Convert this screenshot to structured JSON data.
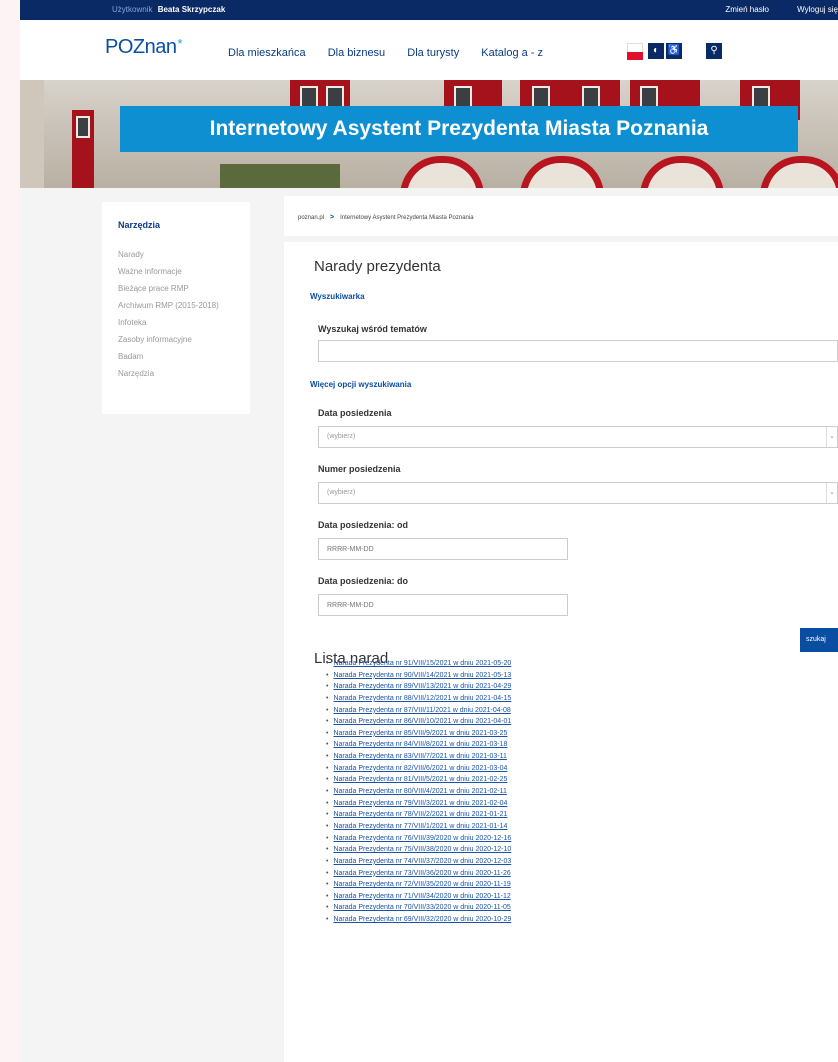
{
  "userbar": {
    "user_label": "Użytkownik",
    "user_name": "Beata Skrzypczak",
    "change_password": "Zmień hasło",
    "logout": "Wyloguj się"
  },
  "header": {
    "logo": "POZnan",
    "logo_star": "*",
    "nav": [
      "Dla mieszkańca",
      "Dla biznesu",
      "Dla turysty",
      "Katalog a - z"
    ],
    "contrast_icon": "◐",
    "accessibility_icon": "♿",
    "search_icon": "⚲"
  },
  "banner": {
    "title": "Internetowy Asystent Prezydenta Miasta Poznania"
  },
  "sidebar": {
    "title": "Narzędzia",
    "items": [
      "Narady",
      "Ważne informacje",
      "Bieżące prace RMP",
      "Archiwum RMP (2015-2018)",
      "Infoteka",
      "Zasoby informacyjne",
      "Badam",
      "Narzędzia"
    ]
  },
  "breadcrumb": {
    "home": "poznan.pl",
    "sep": ">",
    "current": "Internetowy Asystent Prezydenta Miasta Poznania"
  },
  "main": {
    "title": "Narady prezydenta",
    "search_section": "Wyszukiwarka",
    "topic_label": "Wyszukaj wśród tematów",
    "topic_value": "",
    "more_options": "Więcej opcji wyszukiwania",
    "date_label": "Data posiedzenia",
    "date_select": "(wybierz)",
    "number_label": "Numer posiedzenia",
    "number_select": "(wybierz)",
    "from_label": "Data posiedzenia: od",
    "from_placeholder": "RRRR-MM-DD",
    "to_label": "Data posiedzenia: do",
    "to_placeholder": "RRRR-MM-DD",
    "search_button": "szukaj",
    "list_title": "Lista narad",
    "bullet": "•",
    "meetings": [
      "Narada Prezydenta nr 91/VIII/15/2021 w dniu 2021-05-20",
      "Narada Prezydenta nr 90/VIII/14/2021 w dniu 2021-05-13",
      "Narada Prezydenta nr 89/VIII/13/2021 w dniu 2021-04-29",
      "Narada Prezydenta nr 88/VIII/12/2021 w dniu 2021-04-15",
      "Narada Prezydenta nr 87/VIII/11/2021 w dniu 2021-04-08",
      "Narada Prezydenta nr 86/VIII/10/2021 w dniu 2021-04-01",
      "Narada Prezydenta nr 85/VIII/9/2021 w dniu 2021-03-25",
      "Narada Prezydenta nr 84/VIII/8/2021 w dniu 2021-03-18",
      "Narada Prezydenta nr 83/VIII/7/2021 w dniu 2021-03-11",
      "Narada Prezydenta nr 82/VIII/6/2021 w dniu 2021-03-04",
      "Narada Prezydenta nr 81/VIII/5/2021 w dniu 2021-02-25",
      "Narada Prezydenta nr 80/VIII/4/2021 w dniu 2021-02-11",
      "Narada Prezydenta nr 79/VIII/3/2021 w dniu 2021-02-04",
      "Narada Prezydenta nr 78/VIII/2/2021 w dniu 2021-01-21",
      "Narada Prezydenta nr 77/VIII/1/2021 w dniu 2021-01-14",
      "Narada Prezydenta nr 76/VIII/39/2020 w dniu 2020-12-16",
      "Narada Prezydenta nr 75/VIII/38/2020 w dniu 2020-12-10",
      "Narada Prezydenta nr 74/VIII/37/2020 w dniu 2020-12-03",
      "Narada Prezydenta nr 73/VIII/36/2020 w dniu 2020-11-26",
      "Narada Prezydenta nr 72/VIII/35/2020 w dniu 2020-11-19",
      "Narada Prezydenta nr 71/VIII/34/2020 w dniu 2020-11-12",
      "Narada Prezydenta nr 70/VIII/33/2020 w dniu 2020-11-05",
      "Narada Prezydenta nr 69/VIII/32/2020 w dniu 2020-10-29"
    ]
  },
  "colors": {
    "navy": "#0a2a66",
    "link_blue": "#0a4ea2",
    "banner_blue": "#0d8fd1",
    "flag_red": "#e0102a"
  }
}
